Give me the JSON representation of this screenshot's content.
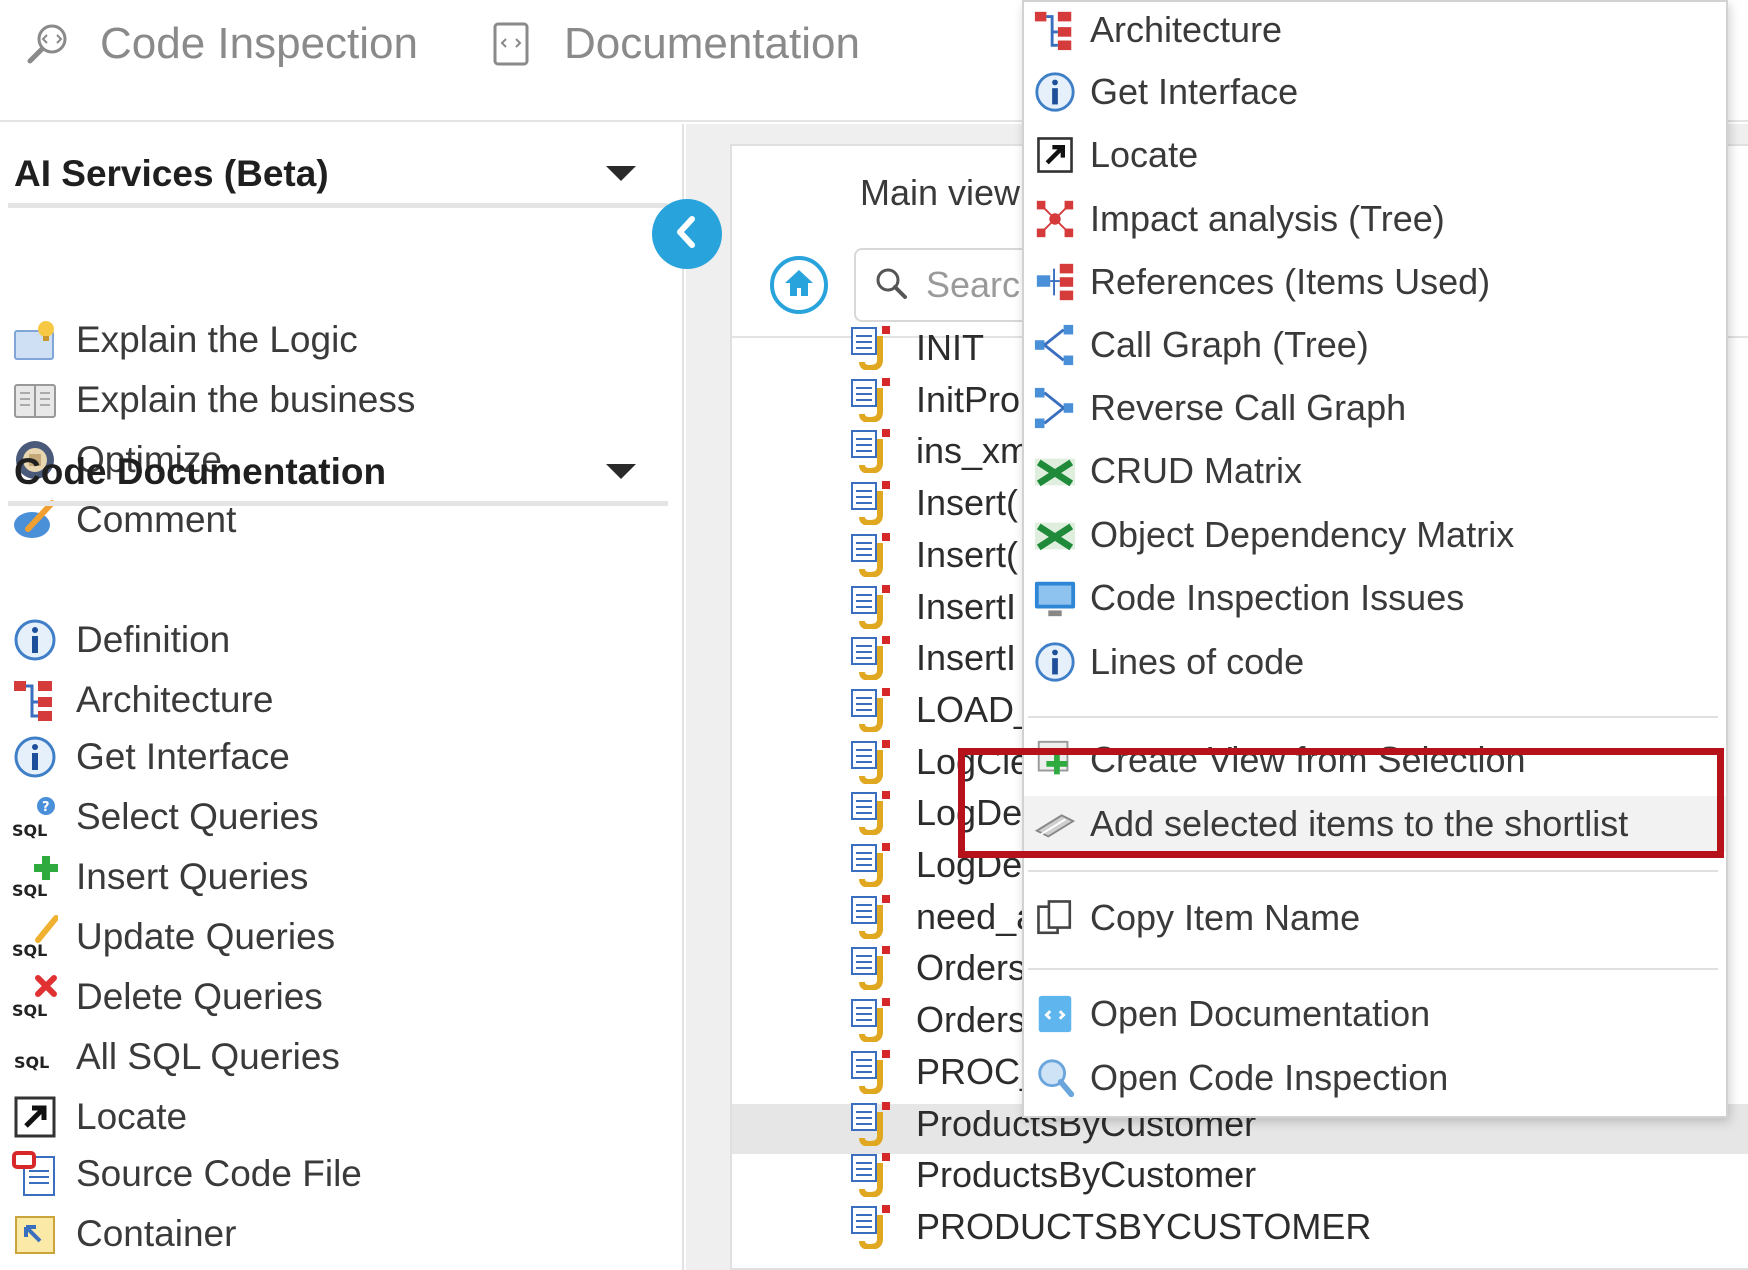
{
  "topbar": {
    "tabs": [
      {
        "label": "Code Inspection",
        "icon": "magnifier-code-icon"
      },
      {
        "label": "Documentation",
        "icon": "document-icon"
      }
    ]
  },
  "sidebar": {
    "sections": [
      {
        "title": "AI Services (Beta)",
        "items": [
          {
            "label": "Explain the Logic",
            "icon": "lightbulb-doc-icon"
          },
          {
            "label": "Explain the business",
            "icon": "book-icon"
          },
          {
            "label": "Optimize",
            "icon": "optimize-icon"
          },
          {
            "label": "Comment",
            "icon": "pen-comment-icon"
          }
        ]
      },
      {
        "title": "Code Documentation",
        "items": [
          {
            "label": "Definition",
            "icon": "info-icon"
          },
          {
            "label": "Architecture",
            "icon": "architecture-icon"
          },
          {
            "label": "Get Interface",
            "icon": "info-icon"
          },
          {
            "label": "Select Queries",
            "icon": "sql-select-icon"
          },
          {
            "label": "Insert Queries",
            "icon": "sql-insert-icon"
          },
          {
            "label": "Update Queries",
            "icon": "sql-update-icon"
          },
          {
            "label": "Delete Queries",
            "icon": "sql-delete-icon"
          },
          {
            "label": "All SQL Queries",
            "icon": "sql-icon"
          },
          {
            "label": "Locate",
            "icon": "locate-icon"
          },
          {
            "label": "Source Code File",
            "icon": "source-file-icon"
          },
          {
            "label": "Container",
            "icon": "container-icon"
          }
        ]
      }
    ]
  },
  "main": {
    "view_label": "Main view",
    "search_placeholder": "Searc",
    "tree_items": [
      "INIT",
      "InitPro",
      "ins_xm",
      "Insert(",
      "Insert(",
      "InsertI",
      "InsertI",
      "LOAD_",
      "LogCle",
      "LogDe",
      "LogDe",
      "need_a",
      "Orders",
      "Orders",
      "PROC_",
      "ProductsByCustomer",
      "ProductsByCustomer",
      "PRODUCTSBYCUSTOMER"
    ]
  },
  "context_menu": {
    "items": [
      {
        "label": "Architecture",
        "icon": "architecture-icon"
      },
      {
        "label": "Get Interface",
        "icon": "info-icon"
      },
      {
        "label": "Locate",
        "icon": "locate-icon"
      },
      {
        "label": "Impact analysis (Tree)",
        "icon": "impact-tree-icon"
      },
      {
        "label": "References (Items Used)",
        "icon": "references-icon"
      },
      {
        "label": "Call Graph (Tree)",
        "icon": "call-graph-icon"
      },
      {
        "label": "Reverse Call Graph",
        "icon": "reverse-call-graph-icon"
      },
      {
        "label": "CRUD Matrix",
        "icon": "matrix-icon"
      },
      {
        "label": "Object Dependency Matrix",
        "icon": "matrix-icon"
      },
      {
        "label": "Code Inspection Issues",
        "icon": "monitor-icon"
      },
      {
        "label": "Lines of code",
        "icon": "info-icon"
      },
      {
        "label": "Create View from Selection",
        "icon": "create-view-icon"
      },
      {
        "label": "Add selected items to the shortlist",
        "icon": "shortlist-icon"
      },
      {
        "label": "Copy Item Name",
        "icon": "copy-icon"
      },
      {
        "label": "Open Documentation",
        "icon": "open-doc-icon"
      },
      {
        "label": "Open Code Inspection",
        "icon": "open-inspection-icon"
      }
    ]
  },
  "colors": {
    "accent": "#29a3db",
    "highlight_border": "#b5121b"
  }
}
